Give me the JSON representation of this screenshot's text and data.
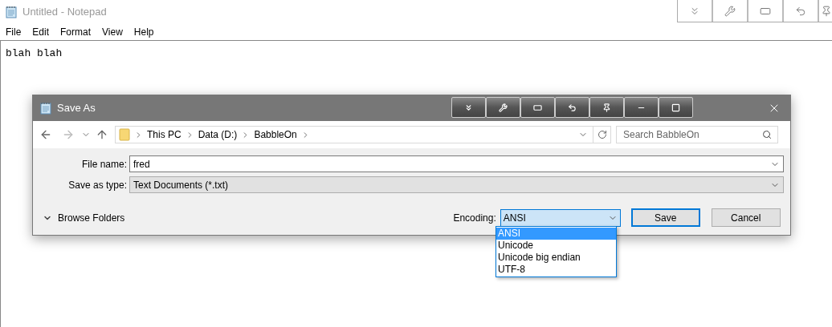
{
  "notepad": {
    "title": "Untitled - Notepad",
    "menu": [
      "File",
      "Edit",
      "Format",
      "View",
      "Help"
    ],
    "content": "blah blah"
  },
  "dialog": {
    "title": "Save As",
    "breadcrumb": [
      "This PC",
      "Data (D:)",
      "BabbleOn"
    ],
    "search": {
      "placeholder": "Search BabbleOn"
    },
    "fields": [
      {
        "label": "File name:",
        "value": "fred",
        "kind": "input"
      },
      {
        "label": "Save as type:",
        "value": "Text Documents (*.txt)",
        "kind": "combo"
      }
    ],
    "browse_folders": "Browse Folders",
    "encoding": {
      "label": "Encoding:",
      "value": "ANSI",
      "options": [
        {
          "label": "ANSI",
          "selected": true
        },
        {
          "label": "Unicode",
          "selected": false
        },
        {
          "label": "Unicode big endian",
          "selected": false
        },
        {
          "label": "UTF-8",
          "selected": false
        }
      ]
    },
    "buttons": [
      {
        "label": "Save",
        "default": true
      },
      {
        "label": "Cancel",
        "default": false
      }
    ]
  }
}
